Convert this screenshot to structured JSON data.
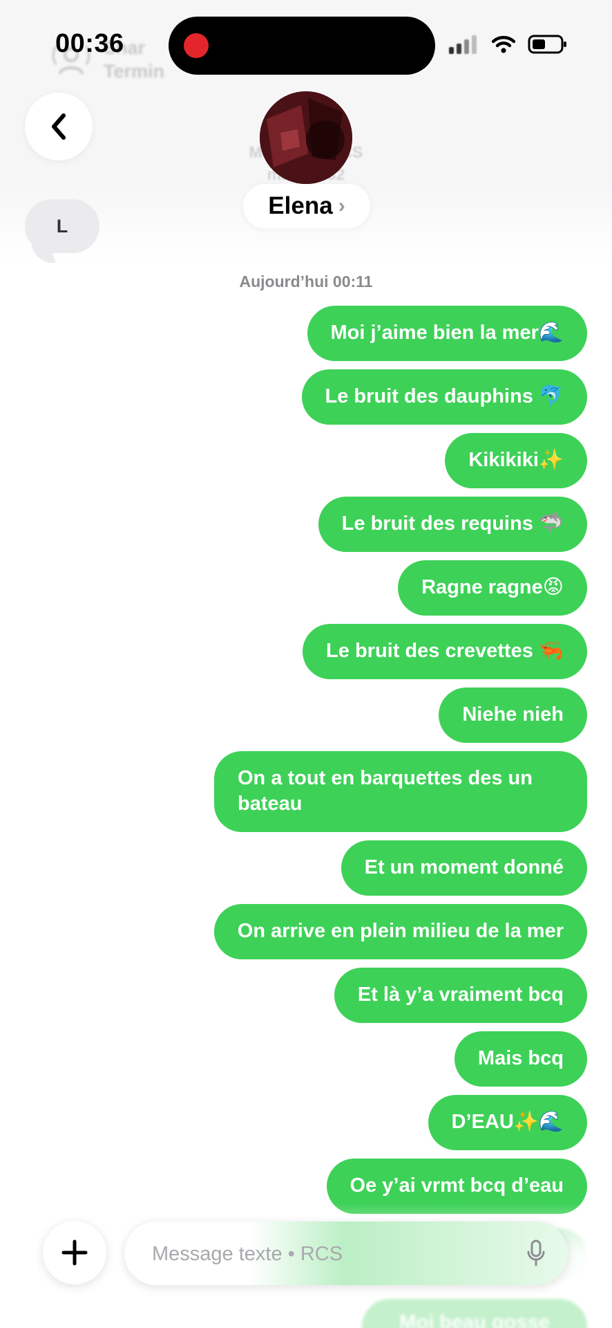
{
  "status_bar": {
    "time": "00:36"
  },
  "ghost_share": {
    "line1": "Shar",
    "line2": "Termin"
  },
  "ghost_meta": {
    "line1": "Messages RCS",
    "line2": "mar. 18:32"
  },
  "contact": {
    "name": "Elena",
    "chevron": "›",
    "initial_bubble": "L"
  },
  "conversation": {
    "timestamp": "Aujourd’hui 00:11",
    "messages": [
      "Moi j’aime bien la mer🌊",
      "Le bruit des dauphins 🐬",
      "Kikikiki✨",
      "Le bruit des requins 🦈",
      "Ragne ragne😡",
      "Le bruit des crevettes 🦐",
      "Niehe nieh",
      "On a tout en barquettes des un bateau",
      "Et un moment donné",
      "On arrive en plein milieu de la mer",
      "Et là y’a vraiment bcq",
      "Mais bcq",
      "D’EAU✨🌊",
      "Oe y’ai vrmt bcq d’eau"
    ],
    "ghost_message": "Moi beau gosse"
  },
  "composer": {
    "placeholder": "Message texte • RCS"
  },
  "colors": {
    "bubble_green": "#3ed158",
    "bubble_text": "#ffffff",
    "incoming_gray": "#ebebee",
    "recording_red": "#e3262c"
  },
  "icons": {
    "back": "chevron-left-icon",
    "plus": "plus-icon",
    "mic": "microphone-icon",
    "wifi": "wifi-icon",
    "battery": "battery-icon",
    "signal": "cellular-signal-icon",
    "share": "shareplay-person-icon"
  }
}
